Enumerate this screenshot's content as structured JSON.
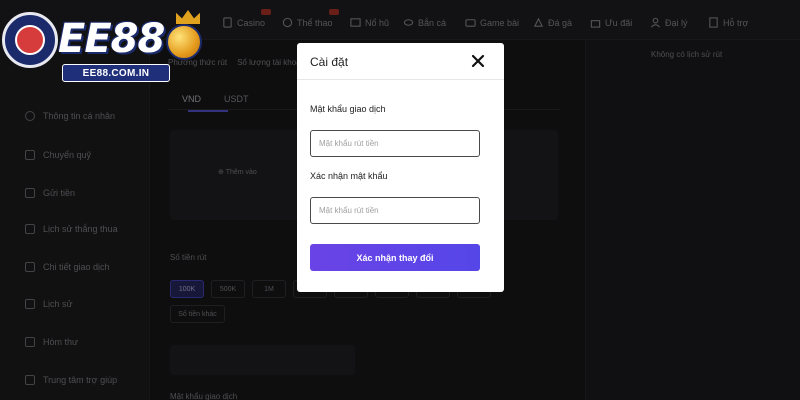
{
  "brand": {
    "logo_text": "EE88",
    "url": "EE88.COM.IN"
  },
  "topnav": {
    "items": [
      {
        "label": "Casino",
        "icon": "cards-icon"
      },
      {
        "label": "Thể thao",
        "icon": "sports-icon"
      },
      {
        "label": "Nổ hũ",
        "icon": "slot-icon"
      },
      {
        "label": "Bắn cá",
        "icon": "fish-icon"
      },
      {
        "label": "Game bài",
        "icon": "card-game-icon"
      },
      {
        "label": "Đá gà",
        "icon": "rooster-icon"
      },
      {
        "label": "Ưu đãi",
        "icon": "gift-icon"
      },
      {
        "label": "Đại lý",
        "icon": "agent-icon"
      },
      {
        "label": "Hỗ trợ",
        "icon": "support-icon"
      }
    ]
  },
  "sidebar": {
    "items": [
      {
        "label": "Thông tin cá nhân"
      },
      {
        "label": "Chuyển quỹ"
      },
      {
        "label": "Gửi tiền"
      },
      {
        "label": "Lịch sử thắng thua"
      },
      {
        "label": "Chi tiết giao dịch"
      },
      {
        "label": "Lịch sử"
      },
      {
        "label": "Hòm thư"
      },
      {
        "label": "Trung tâm trợ giúp"
      }
    ]
  },
  "main": {
    "subtabs": [
      "Phương thức rút",
      "Số lượng tài khoản"
    ],
    "currency_tabs": [
      "VND",
      "USDT"
    ],
    "add_label": "Thêm vào",
    "amount_label": "Số tiền rút",
    "chips": [
      "100K",
      "500K",
      "1M",
      "",
      "",
      "",
      "",
      ""
    ],
    "other_chip": "Số tiền khác",
    "password_label": "Mật khẩu giao dịch"
  },
  "right_panel": {
    "empty_text": "Không có lịch sử rút"
  },
  "modal": {
    "title": "Cài đặt",
    "field1": {
      "label": "Mật khẩu giao dịch",
      "placeholder": "Mật khẩu rút tiền",
      "value": ""
    },
    "field2": {
      "label": "Xác nhận mật khẩu",
      "placeholder": "Mật khẩu rút tiền",
      "value": ""
    },
    "submit_label": "Xác nhận thay đổi"
  },
  "colors": {
    "accent": "#5b46e8",
    "background": "#1b1b1d",
    "modal_bg": "#ffffff"
  }
}
